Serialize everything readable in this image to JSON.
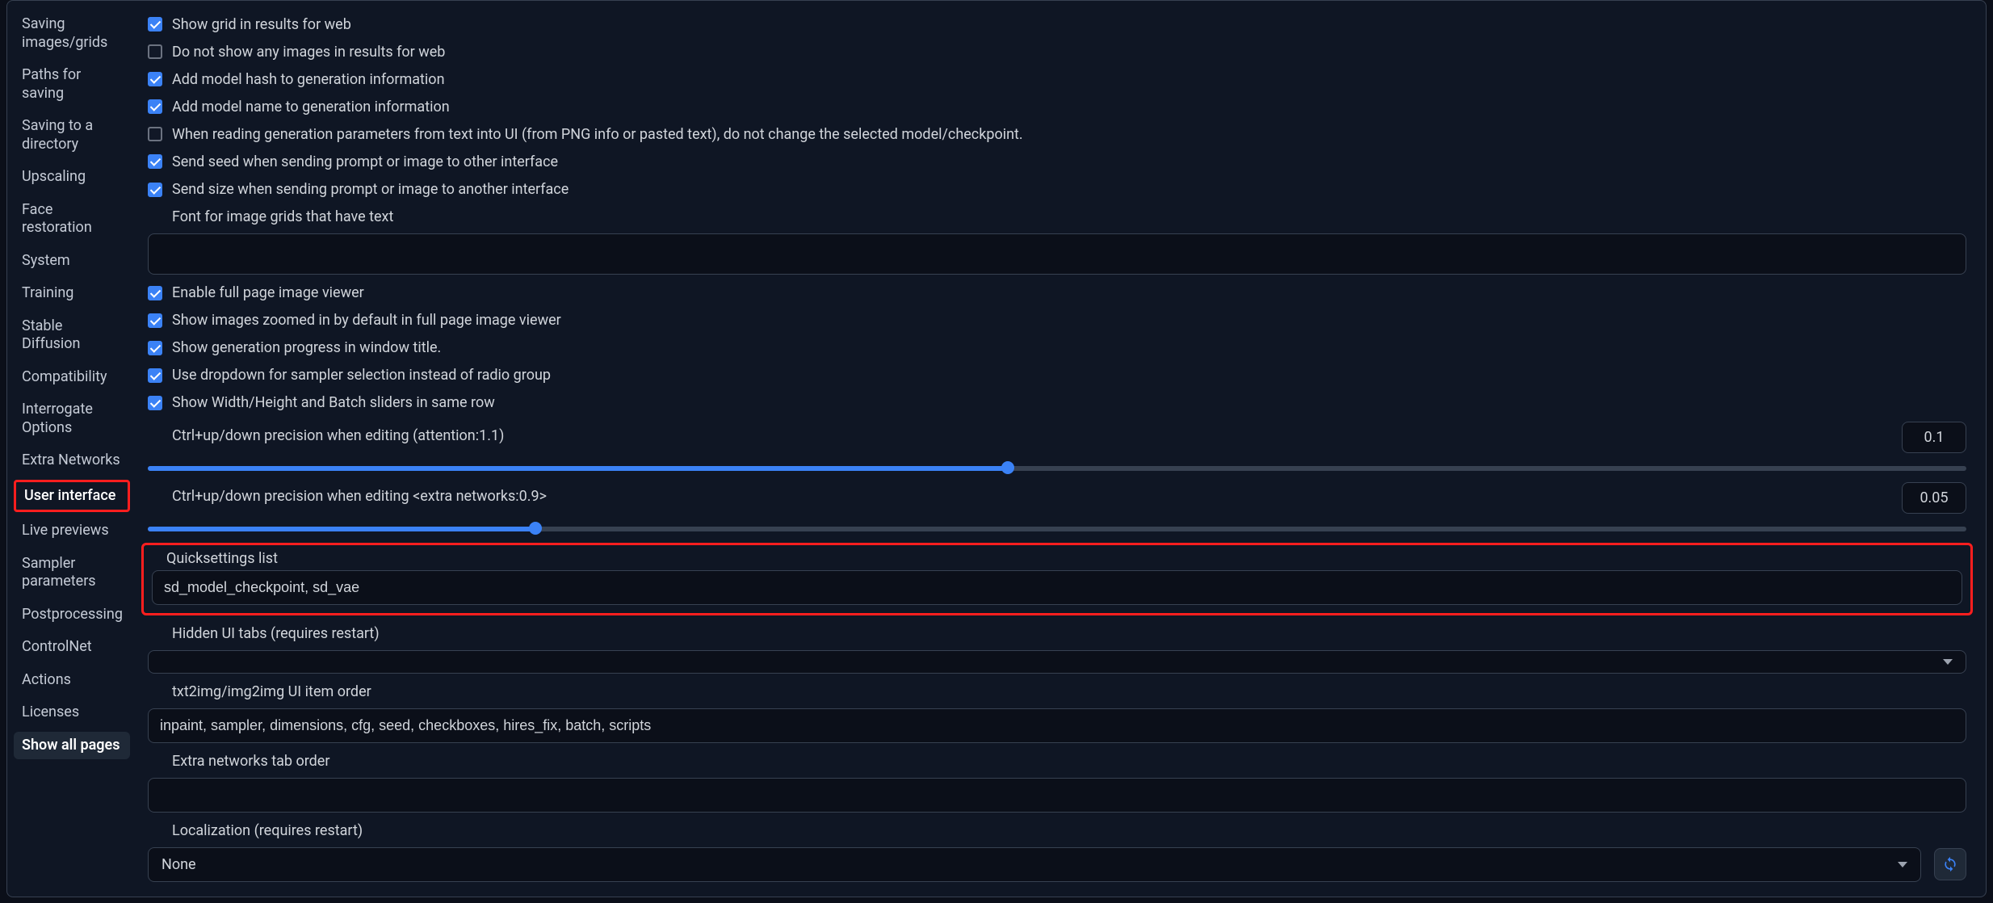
{
  "sidebar": {
    "items": [
      "Saving images/grids",
      "Paths for saving",
      "Saving to a directory",
      "Upscaling",
      "Face restoration",
      "System",
      "Training",
      "Stable Diffusion",
      "Compatibility",
      "Interrogate Options",
      "Extra Networks",
      "User interface",
      "Live previews",
      "Sampler parameters",
      "Postprocessing",
      "ControlNet",
      "Actions",
      "Licenses",
      "Show all pages"
    ],
    "active_index": 11
  },
  "checkboxes": {
    "show_grid": {
      "label": "Show grid in results for web",
      "checked": true
    },
    "no_images": {
      "label": "Do not show any images in results for web",
      "checked": false
    },
    "add_hash": {
      "label": "Add model hash to generation information",
      "checked": true
    },
    "add_name": {
      "label": "Add model name to generation information",
      "checked": true
    },
    "no_change_ckpt": {
      "label": "When reading generation parameters from text into UI (from PNG info or pasted text), do not change the selected model/checkpoint.",
      "checked": false
    },
    "send_seed": {
      "label": "Send seed when sending prompt or image to other interface",
      "checked": true
    },
    "send_size": {
      "label": "Send size when sending prompt or image to another interface",
      "checked": true
    },
    "full_viewer": {
      "label": "Enable full page image viewer",
      "checked": true
    },
    "zoom_default": {
      "label": "Show images zoomed in by default in full page image viewer",
      "checked": true
    },
    "progress_title": {
      "label": "Show generation progress in window title.",
      "checked": true
    },
    "dropdown_sampler": {
      "label": "Use dropdown for sampler selection instead of radio group",
      "checked": true
    },
    "wh_same_row": {
      "label": "Show Width/Height and Batch sliders in same row",
      "checked": true
    }
  },
  "font_label": "Font for image grids that have text",
  "font_value": "",
  "slider1": {
    "label": "Ctrl+up/down precision when editing (attention:1.1)",
    "value": "0.1",
    "fill_pct": 47.3
  },
  "slider2": {
    "label": "Ctrl+up/down precision when editing <extra networks:0.9>",
    "value": "0.05",
    "fill_pct": 21.3
  },
  "quicksettings": {
    "label": "Quicksettings list",
    "value": "sd_model_checkpoint, sd_vae"
  },
  "hidden_tabs": {
    "label": "Hidden UI tabs (requires restart)",
    "value": ""
  },
  "item_order": {
    "label": "txt2img/img2img UI item order",
    "value": "inpaint, sampler, dimensions, cfg, seed, checkboxes, hires_fix, batch, scripts"
  },
  "extra_order": {
    "label": "Extra networks tab order",
    "value": ""
  },
  "localization": {
    "label": "Localization (requires restart)",
    "value": "None"
  }
}
